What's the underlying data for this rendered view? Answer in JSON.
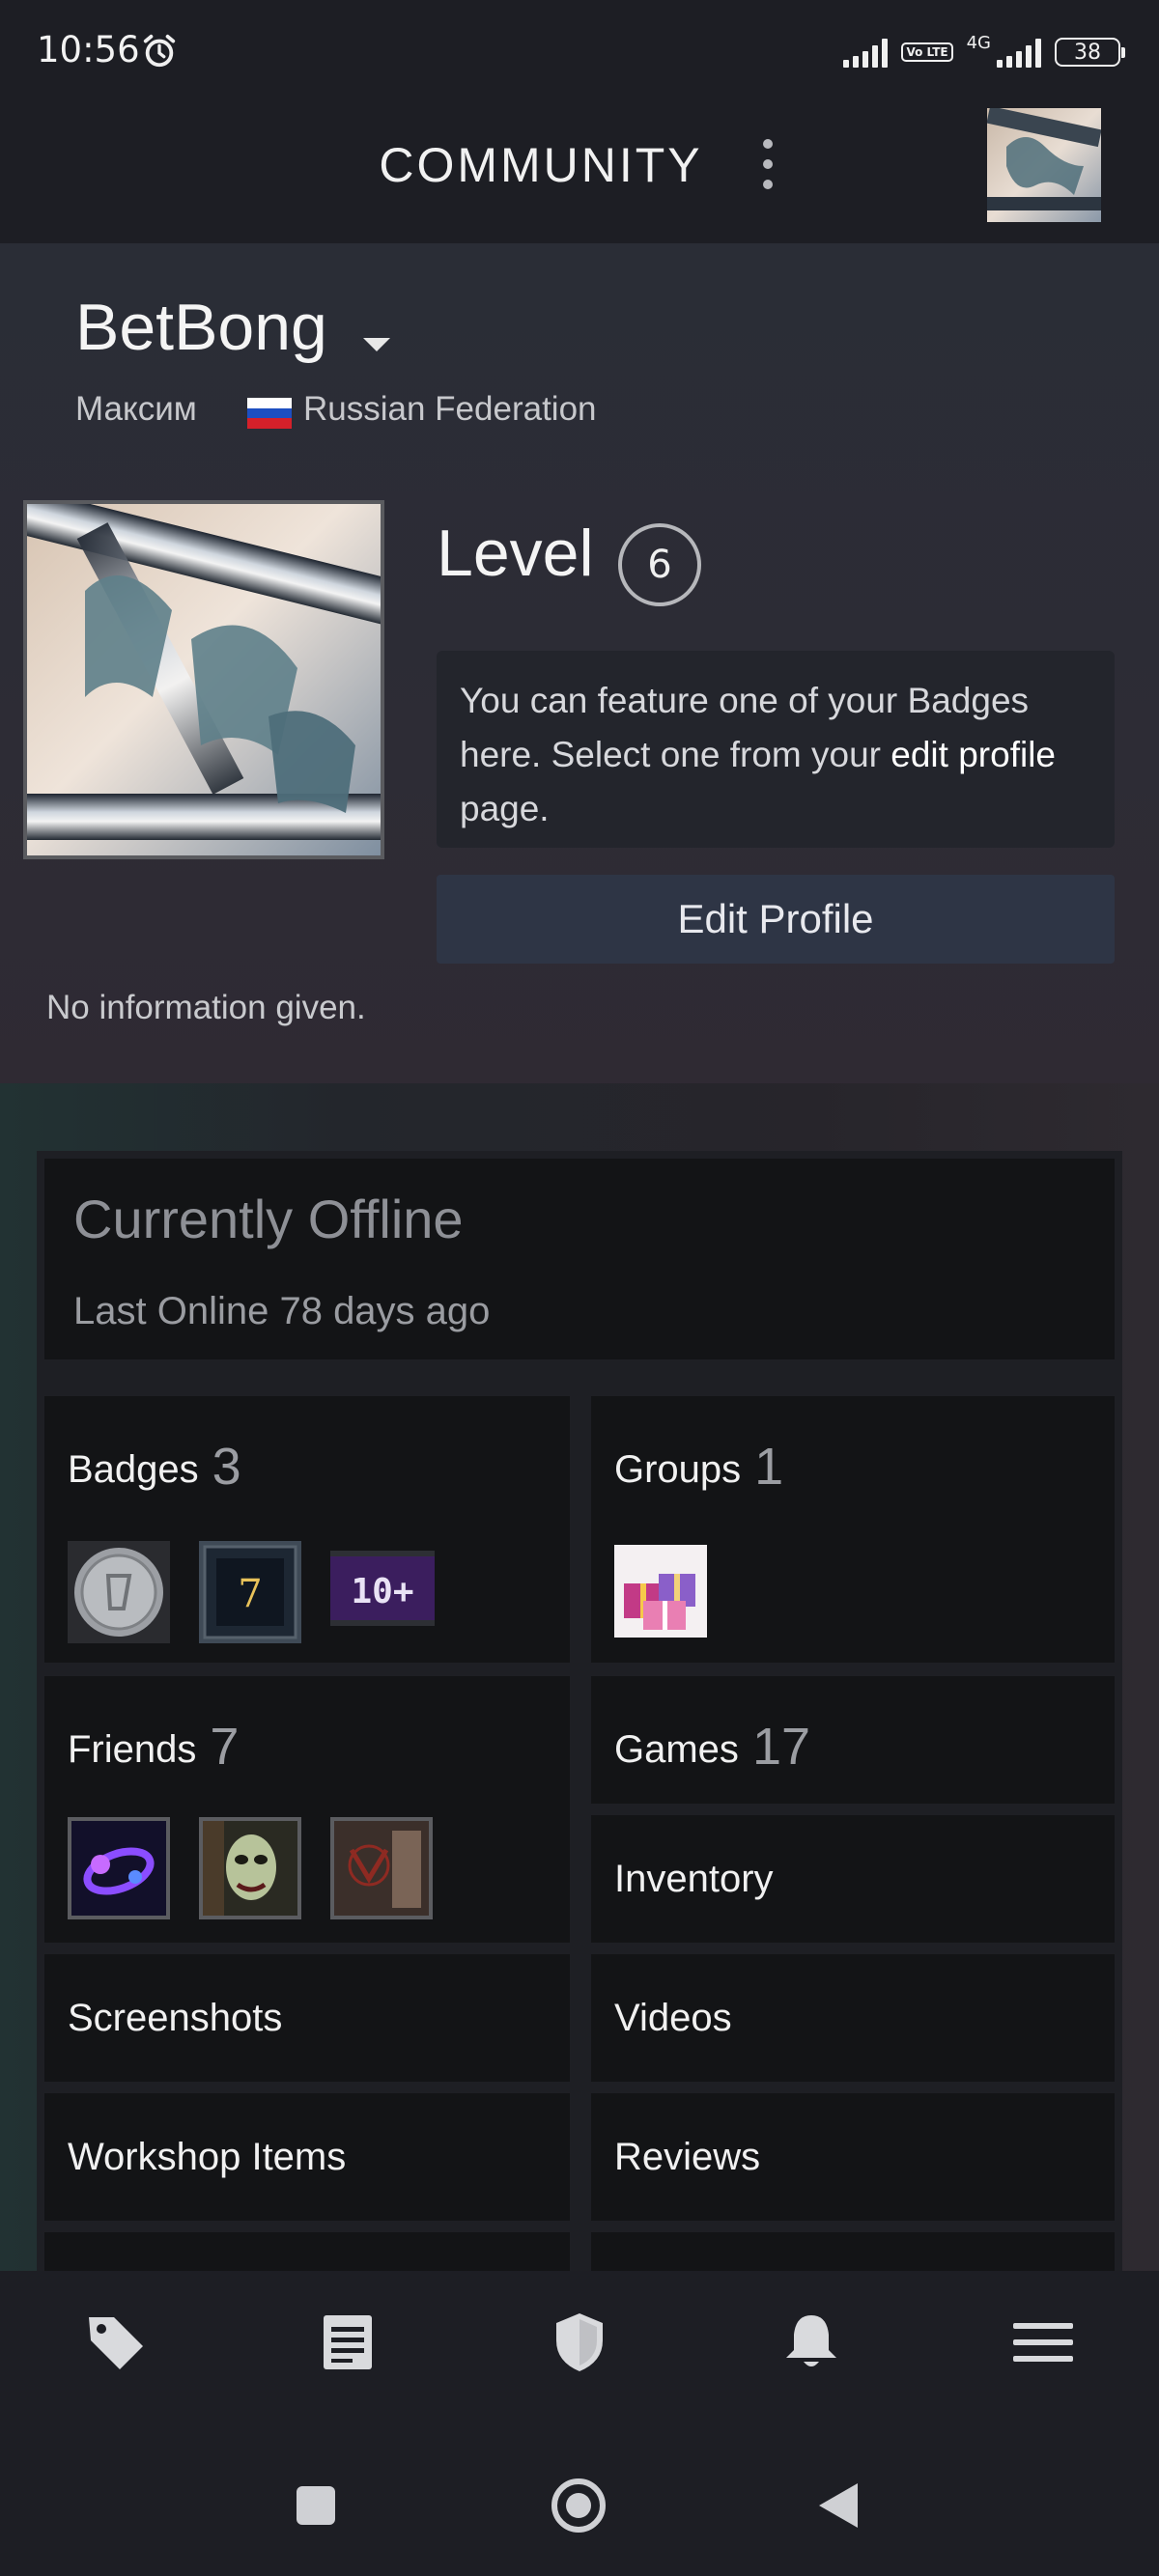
{
  "status_bar": {
    "time": "10:56",
    "network": "4G",
    "volte": "Vo LTE",
    "battery": "38"
  },
  "header": {
    "title": "COMMUNITY"
  },
  "profile": {
    "username": "BetBong",
    "real_name": "Максим",
    "country": "Russian Federation",
    "level_label": "Level",
    "level": "6",
    "badge_note_prefix": "You can feature one of your Badges here. Select one from your",
    "badge_note_link": "edit profile",
    "badge_note_suffix": "page.",
    "edit_button": "Edit Profile",
    "summary": "No information given."
  },
  "status": {
    "state": "Currently Offline",
    "last_online": "Last Online 78 days ago"
  },
  "tiles": {
    "badges": {
      "label": "Badges",
      "count": "3",
      "badge3_text": "10+"
    },
    "groups": {
      "label": "Groups",
      "count": "1"
    },
    "friends": {
      "label": "Friends",
      "count": "7"
    },
    "games": {
      "label": "Games",
      "count": "17"
    },
    "inventory": {
      "label": "Inventory"
    },
    "screenshots": {
      "label": "Screenshots"
    },
    "videos": {
      "label": "Videos"
    },
    "workshop": {
      "label": "Workshop Items"
    },
    "reviews": {
      "label": "Reviews"
    }
  },
  "icons": {
    "alarm": "alarm-clock-icon",
    "menu_dots": "vertical-dots-icon",
    "nav": [
      "tag-icon",
      "news-icon",
      "shield-icon",
      "bell-icon",
      "hamburger-menu-icon"
    ],
    "system": [
      "recents-square-icon",
      "home-circle-icon",
      "back-triangle-icon"
    ]
  },
  "colors": {
    "background": "#1b1c22",
    "panel": "#131416",
    "edit_button": "#2e3545",
    "badge3": "#3b1e5e"
  }
}
